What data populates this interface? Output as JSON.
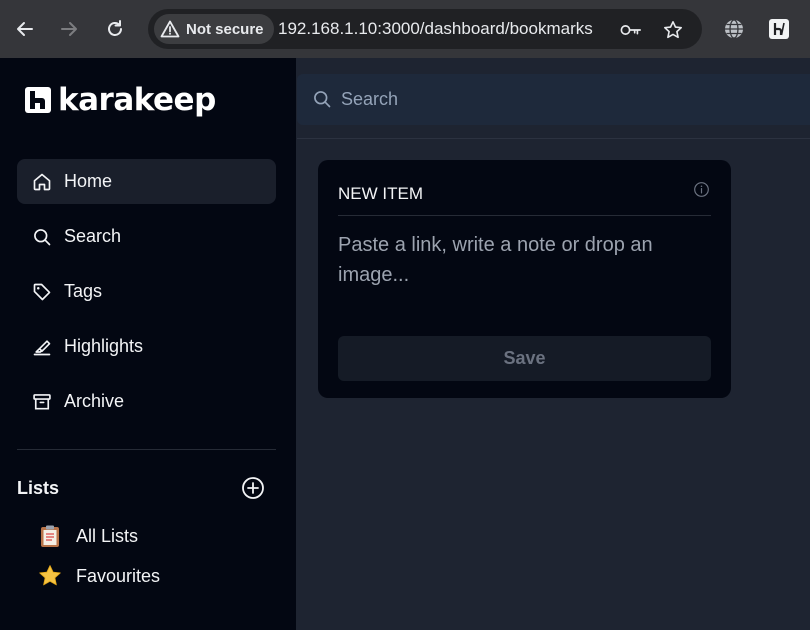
{
  "browser": {
    "security_label": "Not secure",
    "url": "192.168.1.10:3000/dashboard/bookmarks"
  },
  "app": {
    "logo_text": "karakeep"
  },
  "sidebar": {
    "items": [
      {
        "label": "Home",
        "icon": "home-icon",
        "active": true
      },
      {
        "label": "Search",
        "icon": "search-icon"
      },
      {
        "label": "Tags",
        "icon": "tag-icon"
      },
      {
        "label": "Highlights",
        "icon": "highlighter-icon"
      },
      {
        "label": "Archive",
        "icon": "archive-icon"
      }
    ],
    "lists_title": "Lists",
    "lists": [
      {
        "label": "All Lists",
        "icon": "clipboard-emoji"
      },
      {
        "label": "Favourites",
        "icon": "star-emoji"
      }
    ]
  },
  "search": {
    "placeholder": "Search"
  },
  "new_item": {
    "title": "NEW ITEM",
    "placeholder": "Paste a link, write a note or drop an image...",
    "save_label": "Save"
  },
  "colors": {
    "sidebar_bg": "#030712",
    "main_bg": "#1e2431",
    "card_bg": "#030712",
    "search_bg": "#1e293b"
  }
}
